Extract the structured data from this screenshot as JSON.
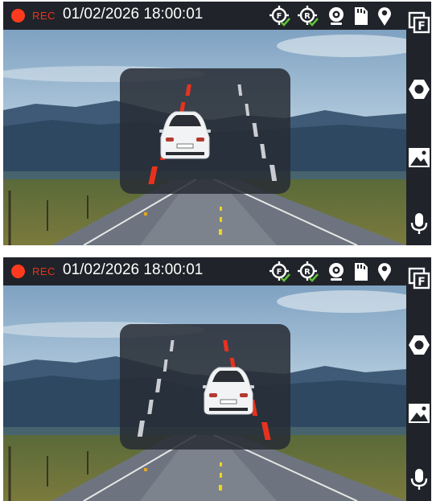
{
  "screens": [
    {
      "status": {
        "rec_label": "REC",
        "datetime": "01/02/2026 18:00:01",
        "icons": [
          "front-camera-ok-icon",
          "rear-camera-ok-icon",
          "webcam-icon",
          "sd-card-icon",
          "gps-pin-icon"
        ]
      },
      "sidebar": {
        "buttons": [
          "camera-switch-icon",
          "stop-icon",
          "gallery-icon",
          "microphone-icon"
        ],
        "camera_switch_letter": "F"
      },
      "adas": {
        "lane_departure_side": "left"
      }
    },
    {
      "status": {
        "rec_label": "REC",
        "datetime": "01/02/2026 18:00:01",
        "icons": [
          "front-camera-ok-icon",
          "rear-camera-ok-icon",
          "webcam-icon",
          "sd-card-icon",
          "gps-pin-icon"
        ]
      },
      "sidebar": {
        "buttons": [
          "camera-switch-icon",
          "stop-icon",
          "gallery-icon",
          "microphone-icon"
        ],
        "camera_switch_letter": "F"
      },
      "adas": {
        "lane_departure_side": "right"
      }
    }
  ],
  "colors": {
    "rec_red": "#ff3b1f",
    "lane_warning": "#e8321e",
    "check_green": "#5fc23a",
    "bar_bg": "#202329"
  }
}
